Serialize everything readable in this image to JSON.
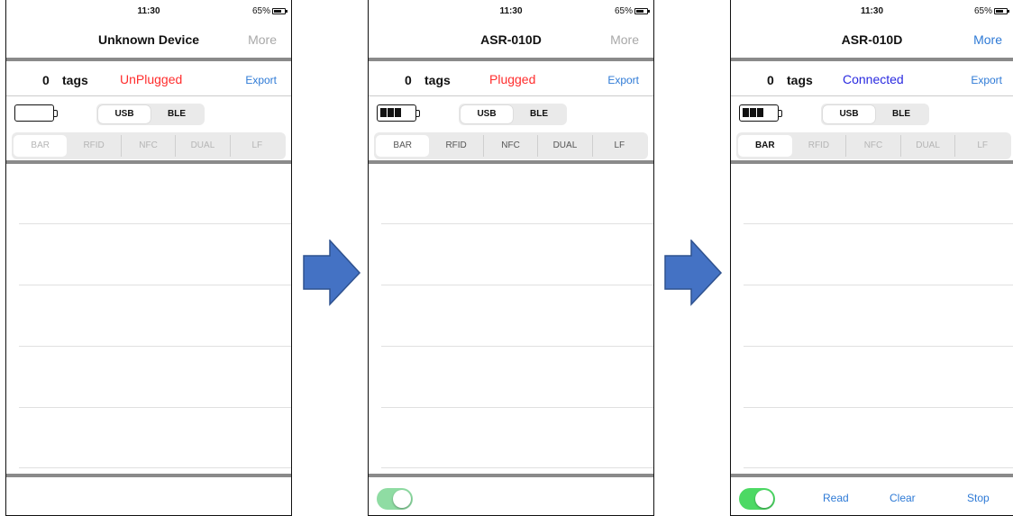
{
  "screens": [
    {
      "time": "11:30",
      "battery_percent_label": "65%",
      "title": "Unknown Device",
      "more_label": "More",
      "more_enabled": false,
      "tag_count": "0",
      "tags_label": "tags",
      "status_text": "UnPlugged",
      "status_color": "#ff2d2d",
      "export_label": "Export",
      "device_battery_bars": 0,
      "connection_options": [
        "USB",
        "BLE"
      ],
      "connection_selected": "USB",
      "scan_tabs": [
        "BAR",
        "RFID",
        "NFC",
        "DUAL",
        "LF"
      ],
      "scan_tab_selected": "BAR",
      "tabs_enabled": false,
      "toggle_visible": false,
      "actions": []
    },
    {
      "time": "11:30",
      "battery_percent_label": "65%",
      "title": "ASR-010D",
      "more_label": "More",
      "more_enabled": false,
      "tag_count": "0",
      "tags_label": "tags",
      "status_text": "Plugged",
      "status_color": "#ff2d2d",
      "export_label": "Export",
      "device_battery_bars": 3,
      "connection_options": [
        "USB",
        "BLE"
      ],
      "connection_selected": "USB",
      "scan_tabs": [
        "BAR",
        "RFID",
        "NFC",
        "DUAL",
        "LF"
      ],
      "scan_tab_selected": "BAR",
      "tabs_enabled": true,
      "toggle_visible": true,
      "toggle_color": "#8fdca3",
      "actions": []
    },
    {
      "time": "11:30",
      "battery_percent_label": "65%",
      "title": "ASR-010D",
      "more_label": "More",
      "more_enabled": true,
      "tag_count": "0",
      "tags_label": "tags",
      "status_text": "Connected",
      "status_color": "#2a2ae0",
      "export_label": "Export",
      "device_battery_bars": 3,
      "connection_options": [
        "USB",
        "BLE"
      ],
      "connection_selected": "USB",
      "scan_tabs": [
        "BAR",
        "RFID",
        "NFC",
        "DUAL",
        "LF"
      ],
      "scan_tab_selected": "BAR",
      "tabs_enabled": false,
      "toggle_visible": true,
      "toggle_color": "#4cd964",
      "actions": [
        "Read",
        "Clear",
        "Stop"
      ]
    }
  ],
  "colors": {
    "accent_blue": "#2e7ad6",
    "arrow_fill": "#4472c4",
    "arrow_stroke": "#2f528f",
    "disabled_gray": "#a8a8a8"
  }
}
